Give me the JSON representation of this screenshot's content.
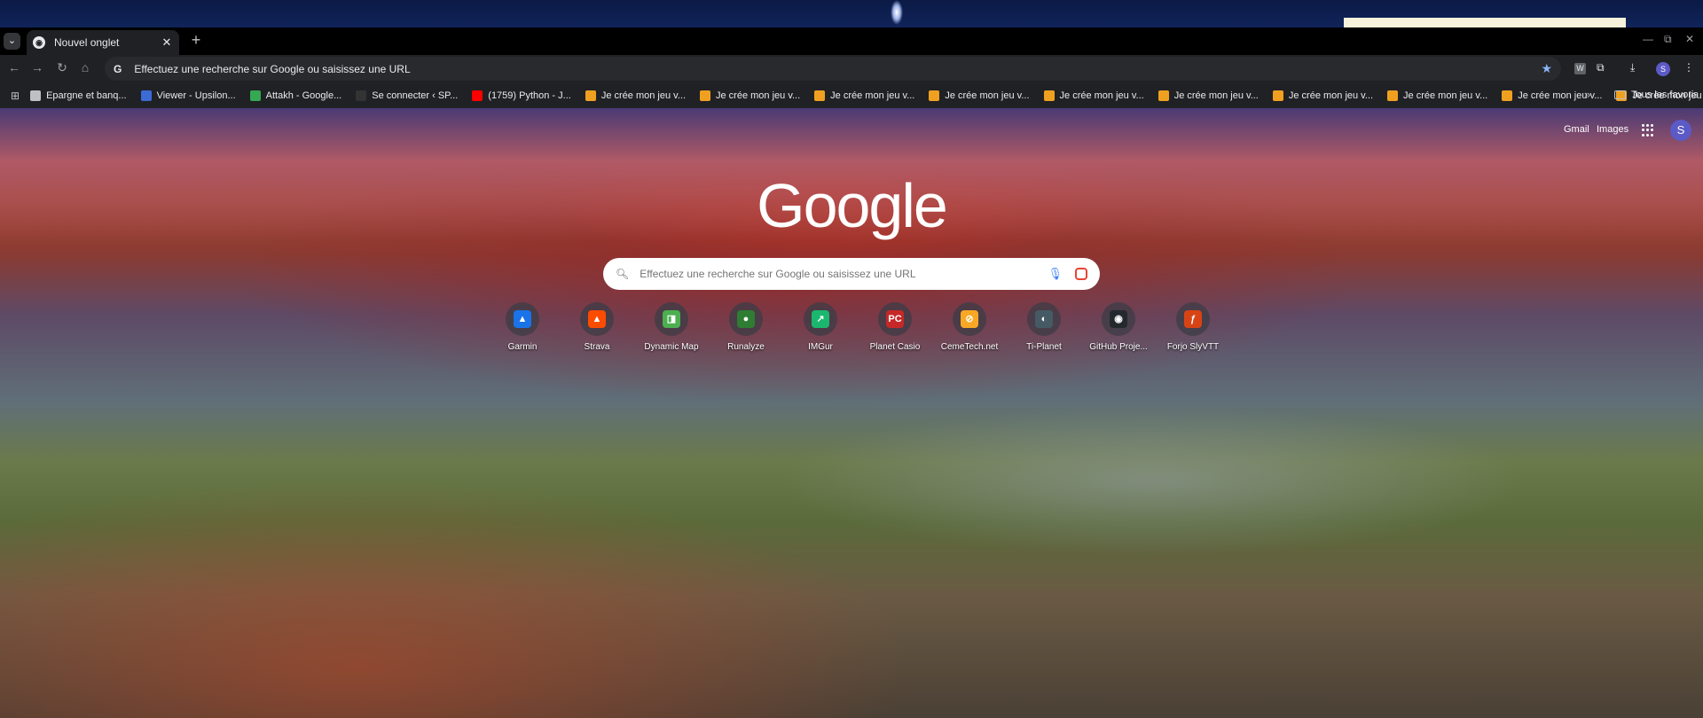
{
  "browser": {
    "tab": {
      "title": "Nouvel onglet",
      "favicon": "chrome-icon"
    },
    "omnibox": {
      "text": "Effectuez une recherche sur Google ou saisissez une URL"
    },
    "window_controls": {
      "minimize": "—",
      "restore": "⧉",
      "close": "✕"
    }
  },
  "bookmarks": {
    "items": [
      {
        "label": "Epargne et banq...",
        "icon": "folder-icon",
        "color": "#bdc1c6"
      },
      {
        "label": "Viewer - Upsilon...",
        "icon": "upsilon-icon",
        "color": "#3c6bd6"
      },
      {
        "label": "Attakh - Google...",
        "icon": "drive-icon",
        "color": "#34a853"
      },
      {
        "label": "Se connecter ‹ SP...",
        "icon": "wordpress-icon",
        "color": "#333333"
      },
      {
        "label": "(1759) Python - J...",
        "icon": "youtube-icon",
        "color": "#ff0000"
      },
      {
        "label": "Je crée mon jeu v...",
        "icon": "game-icon",
        "color": "#f0a020"
      },
      {
        "label": "Je crée mon jeu v...",
        "icon": "game-icon",
        "color": "#f0a020"
      },
      {
        "label": "Je crée mon jeu v...",
        "icon": "game-icon",
        "color": "#f0a020"
      },
      {
        "label": "Je crée mon jeu v...",
        "icon": "game-icon",
        "color": "#f0a020"
      },
      {
        "label": "Je crée mon jeu v...",
        "icon": "game-icon",
        "color": "#f0a020"
      },
      {
        "label": "Je crée mon jeu v...",
        "icon": "game-icon",
        "color": "#f0a020"
      },
      {
        "label": "Je crée mon jeu v...",
        "icon": "game-icon",
        "color": "#f0a020"
      },
      {
        "label": "Je crée mon jeu v...",
        "icon": "game-icon",
        "color": "#f0a020"
      },
      {
        "label": "Je crée mon jeu v...",
        "icon": "game-icon",
        "color": "#f0a020"
      },
      {
        "label": "Je crée mon jeu v...",
        "icon": "game-icon",
        "color": "#f0a020"
      }
    ],
    "more": "»",
    "all_label": "Tous les favoris"
  },
  "ntp": {
    "links": {
      "gmail": "Gmail",
      "images": "Images"
    },
    "avatar_letter": "S",
    "logo": "Google",
    "search_placeholder": "Effectuez une recherche sur Google ou saisissez une URL",
    "shortcuts": [
      {
        "label": "Garmin",
        "icon": "garmin-icon",
        "color": "#1a73e8",
        "glyph": "▲"
      },
      {
        "label": "Strava",
        "icon": "strava-icon",
        "color": "#fc4c02",
        "glyph": "▲"
      },
      {
        "label": "Dynamic Map",
        "icon": "map-icon",
        "color": "#4caf50",
        "glyph": "◨"
      },
      {
        "label": "Runalyze",
        "icon": "runalyze-icon",
        "color": "#2e7d32",
        "glyph": "●"
      },
      {
        "label": "IMGur",
        "icon": "imgur-icon",
        "color": "#1bb76e",
        "glyph": "↗"
      },
      {
        "label": "Planet Casio",
        "icon": "planet-casio-icon",
        "color": "#c62828",
        "glyph": "PC"
      },
      {
        "label": "CemeTech.net",
        "icon": "cemetech-icon",
        "color": "#f9a825",
        "glyph": "⊘"
      },
      {
        "label": "Ti-Planet",
        "icon": "ti-planet-icon",
        "color": "#455a64",
        "glyph": "◐"
      },
      {
        "label": "GitHub Proje...",
        "icon": "github-icon",
        "color": "#24292e",
        "glyph": "◉"
      },
      {
        "label": "Forjo SlyVTT",
        "icon": "forjo-icon",
        "color": "#d84315",
        "glyph": "ƒ"
      }
    ]
  }
}
